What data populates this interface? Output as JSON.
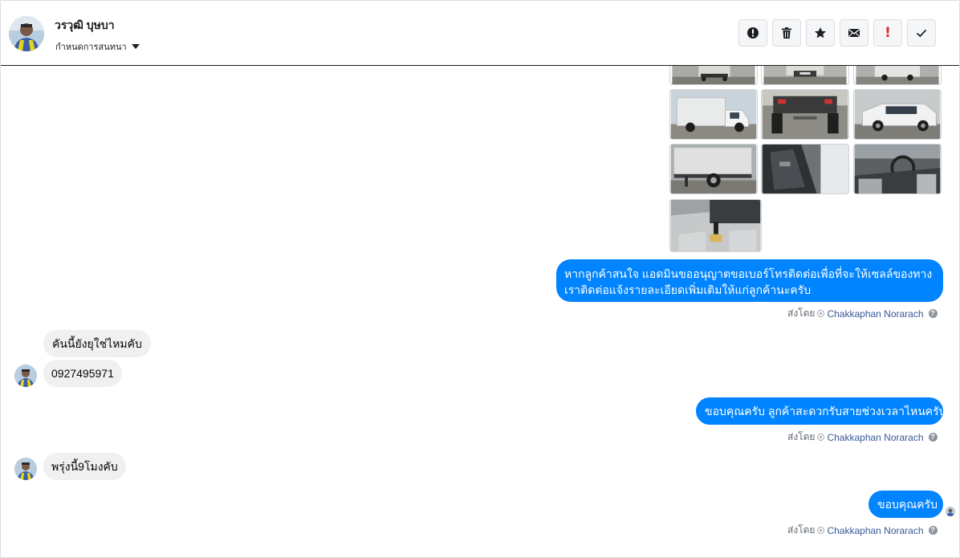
{
  "header": {
    "name": "วรวุฒิ บุษบา",
    "sub_label": "กำหนดการสนทนา",
    "tools": [
      {
        "name": "info-button",
        "icon": "info-icon"
      },
      {
        "name": "delete-button",
        "icon": "trash-icon"
      },
      {
        "name": "star-button",
        "icon": "star-icon"
      },
      {
        "name": "mail-button",
        "icon": "mail-icon"
      },
      {
        "name": "flag-important-button",
        "icon": "exclamation-icon",
        "glyph": "!"
      },
      {
        "name": "mark-done-button",
        "icon": "check-icon"
      }
    ]
  },
  "thread": {
    "messages": [
      {
        "from": "page",
        "text": "หากลูกค้าสนใจ แอดมินขออนุญาตขอเบอร์โทรติดต่อเพื่อที่จะให้เซลล์ของทางเราติดต่อแจ้งรายละเอียดเพิ่มเติมให้แก่ลูกค้านะครับ"
      },
      {
        "from": "customer",
        "text": "คันนี้ยังยุใช่ไหมคับ"
      },
      {
        "from": "customer",
        "text": "0927495971"
      },
      {
        "from": "page",
        "text": "ขอบคุณครับ ลูกค้าสะดวกรับสายช่วงเวลาไหนครับ"
      },
      {
        "from": "customer",
        "text": "พรุ่งนี้9โมงคับ"
      },
      {
        "from": "page",
        "text": "ขอบคุณครับ"
      }
    ],
    "sent_by_prefix": "ส่งโดย",
    "agent_name": "Chakkaphan Norarach",
    "help_glyph": "?"
  },
  "colors": {
    "outgoing_bubble": "#0084ff",
    "incoming_bubble": "#f1f0f0",
    "agent_link": "#385898"
  }
}
